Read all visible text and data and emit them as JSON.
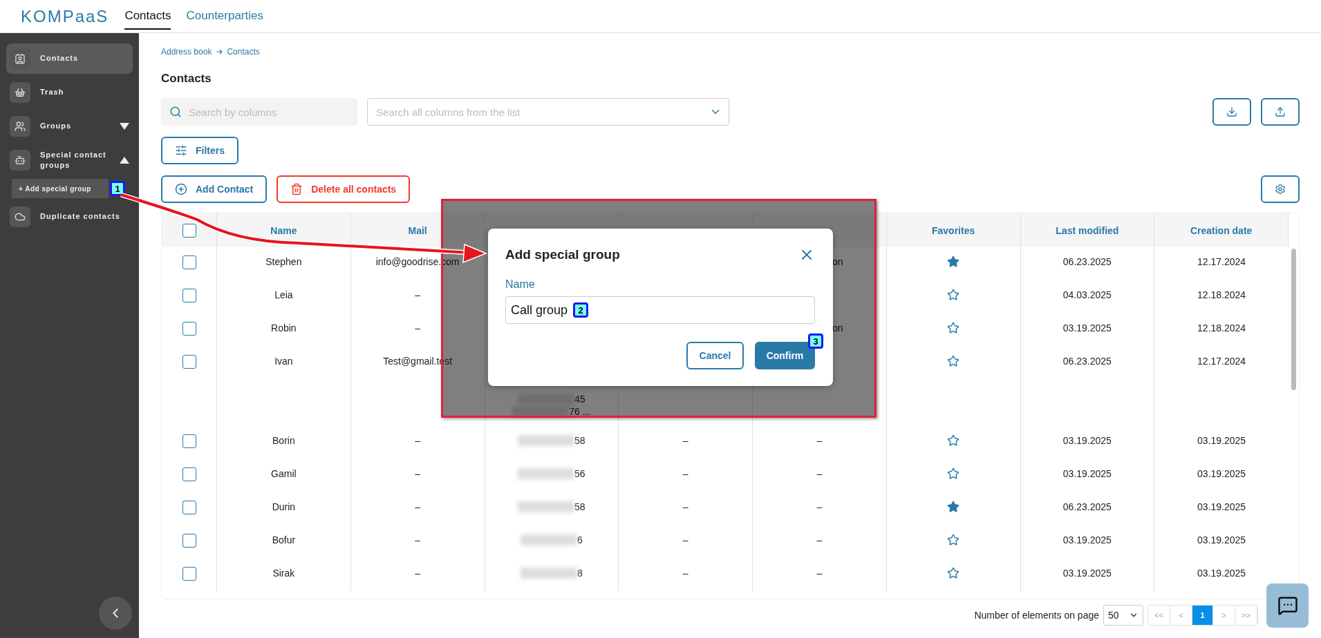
{
  "header": {
    "logo": "KOMPaaS",
    "tabs": [
      {
        "label": "Contacts",
        "selected": true
      },
      {
        "label": "Counterparties",
        "selected": false
      }
    ]
  },
  "sidebar": {
    "items": [
      {
        "kind": "item",
        "label": "Contacts",
        "selected": true
      },
      {
        "kind": "item",
        "label": "Trash",
        "selected": false
      },
      {
        "kind": "group",
        "label": "Groups",
        "selected": false,
        "expanded": false
      },
      {
        "kind": "group",
        "label": "Special contact groups",
        "selected": false,
        "expanded": true
      },
      {
        "kind": "sub",
        "label": "+ Add special group",
        "badge": "1"
      },
      {
        "kind": "item",
        "label": "Duplicate contacts",
        "selected": false
      }
    ]
  },
  "breadcrumb": [
    "Address book",
    "Contacts"
  ],
  "title": "Contacts",
  "search": {
    "placeholder": "Search by columns"
  },
  "column_select": {
    "placeholder": "Search all columns from the list"
  },
  "filters_button": "Filters",
  "add_button": "Add Contact",
  "delete_button": "Delete all contacts",
  "table": {
    "header_checked": false,
    "columns_left": [
      "Name",
      "Mail"
    ],
    "columns_right": [
      "Favorites",
      "Last modified",
      "Creation date"
    ],
    "rows": [
      {
        "checked": false,
        "name": "Stephen",
        "mail": "info@goodrise.com",
        "groups": {
          "text": "on",
          "partial": true
        },
        "favorite": true,
        "modified": "06.23.2025",
        "created": "12.17.2024"
      },
      {
        "checked": false,
        "name": "Leia",
        "mail": "–",
        "favorite": false,
        "modified": "04.03.2025",
        "created": "12.18.2024"
      },
      {
        "checked": false,
        "name": "Robin",
        "mail": "–",
        "groups": {
          "text": "on",
          "partial": true
        },
        "favorite": false,
        "modified": "03.19.2025",
        "created": "12.18.2024"
      },
      {
        "checked": false,
        "name": "Ivan",
        "mail": "Test@gmail.test",
        "phone": {
          "kind": "multiline",
          "lines": [
            "45",
            "76 ..."
          ]
        },
        "favorite": false,
        "modified": "06.23.2025",
        "created": "12.17.2024"
      },
      {
        "checked": false,
        "name": "Borin",
        "mail": "–",
        "phone": {
          "kind": "single",
          "lines": [
            "58"
          ]
        },
        "company": "–",
        "groups": {
          "text": "–",
          "partial": false
        },
        "favorite": false,
        "modified": "03.19.2025",
        "created": "03.19.2025"
      },
      {
        "checked": false,
        "name": "Gamil",
        "mail": "–",
        "phone": {
          "kind": "single",
          "lines": [
            "56"
          ]
        },
        "company": "–",
        "groups": {
          "text": "–",
          "partial": false
        },
        "favorite": false,
        "modified": "03.19.2025",
        "created": "03.19.2025"
      },
      {
        "checked": false,
        "name": "Durin",
        "mail": "–",
        "phone": {
          "kind": "single",
          "lines": [
            "58"
          ]
        },
        "company": "–",
        "groups": {
          "text": "–",
          "partial": false
        },
        "favorite": true,
        "modified": "06.23.2025",
        "created": "03.19.2025"
      },
      {
        "checked": false,
        "name": "Bofur",
        "mail": "–",
        "phone": {
          "kind": "single",
          "lines": [
            "6"
          ]
        },
        "company": "–",
        "groups": {
          "text": "–",
          "partial": false
        },
        "favorite": false,
        "modified": "03.19.2025",
        "created": "03.19.2025"
      },
      {
        "checked": false,
        "name": "Sirak",
        "mail": "–",
        "phone": {
          "kind": "single",
          "lines": [
            "8"
          ]
        },
        "company": "–",
        "groups": {
          "text": "–",
          "partial": false
        },
        "favorite": false,
        "modified": "03.19.2025",
        "created": "03.19.2025"
      }
    ]
  },
  "pagination": {
    "label": "Number of elements on page",
    "page_size": "50",
    "pages": [
      {
        "label": "<<",
        "selected": false
      },
      {
        "label": "<",
        "selected": false
      },
      {
        "label": "1",
        "selected": true
      },
      {
        "label": ">",
        "selected": false
      },
      {
        "label": ">>",
        "selected": false
      }
    ]
  },
  "dialog": {
    "title": "Add special group",
    "field_label": "Name",
    "value": "Call group",
    "value_badge": "2",
    "buttons": [
      {
        "kind": "secondary",
        "label": "Cancel"
      },
      {
        "kind": "primary",
        "label": "Confirm",
        "badge": "3"
      }
    ]
  }
}
